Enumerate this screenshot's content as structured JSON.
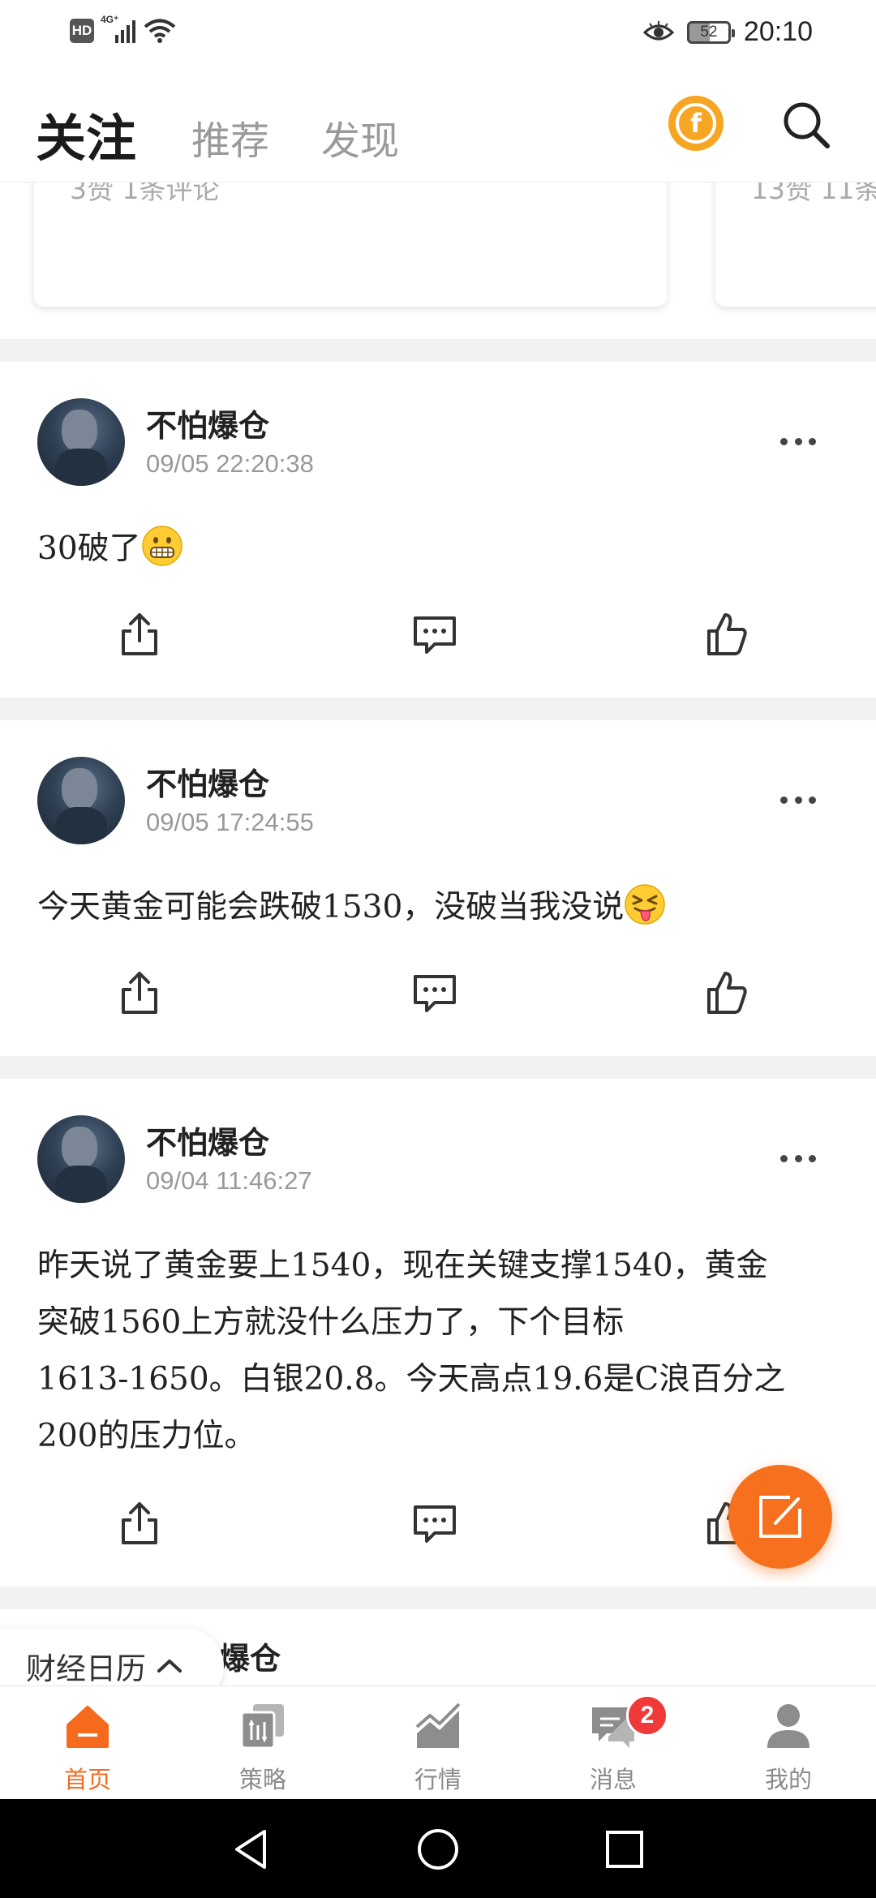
{
  "status_bar": {
    "hd": "HD",
    "network": "4G⁺",
    "battery": "52",
    "time": "20:10"
  },
  "header": {
    "tabs": [
      {
        "label": "关注",
        "active": true
      },
      {
        "label": "推荐",
        "active": false
      },
      {
        "label": "发现",
        "active": false
      }
    ],
    "coin_symbol": "f",
    "accent_color": "#f7701e"
  },
  "top_cards": [
    {
      "stats": "3赞 1条评论"
    },
    {
      "stats": "13赞 11条"
    }
  ],
  "posts": [
    {
      "author": "不怕爆仓",
      "time": "09/05 22:20:38",
      "text": "30破了",
      "emoji": "grimacing-emoji"
    },
    {
      "author": "不怕爆仓",
      "time": "09/05 17:24:55",
      "text": "今天黄金可能会跌破1530，没破当我没说",
      "emoji": "tongue-out-emoji"
    },
    {
      "author": "不怕爆仓",
      "time": "09/04 11:46:27",
      "lines": [
        "昨天说了黄金要上1540，现在关键支撑1540，黄金",
        "突破1560上方就没什么压力了，下个目标",
        "1613-1650。白银20.8。今天高点19.6是C浪百分之",
        "200的压力位。"
      ]
    },
    {
      "author_partial": "爆仓"
    }
  ],
  "calendar_chip": {
    "label": "财经日历"
  },
  "bottom_nav": [
    {
      "label": "首页",
      "icon": "home-icon",
      "active": true
    },
    {
      "label": "策略",
      "icon": "strategy-icon",
      "active": false
    },
    {
      "label": "行情",
      "icon": "market-chart-icon",
      "active": false
    },
    {
      "label": "消息",
      "icon": "message-icon",
      "active": false,
      "badge": "2"
    },
    {
      "label": "我的",
      "icon": "profile-icon",
      "active": false
    }
  ]
}
